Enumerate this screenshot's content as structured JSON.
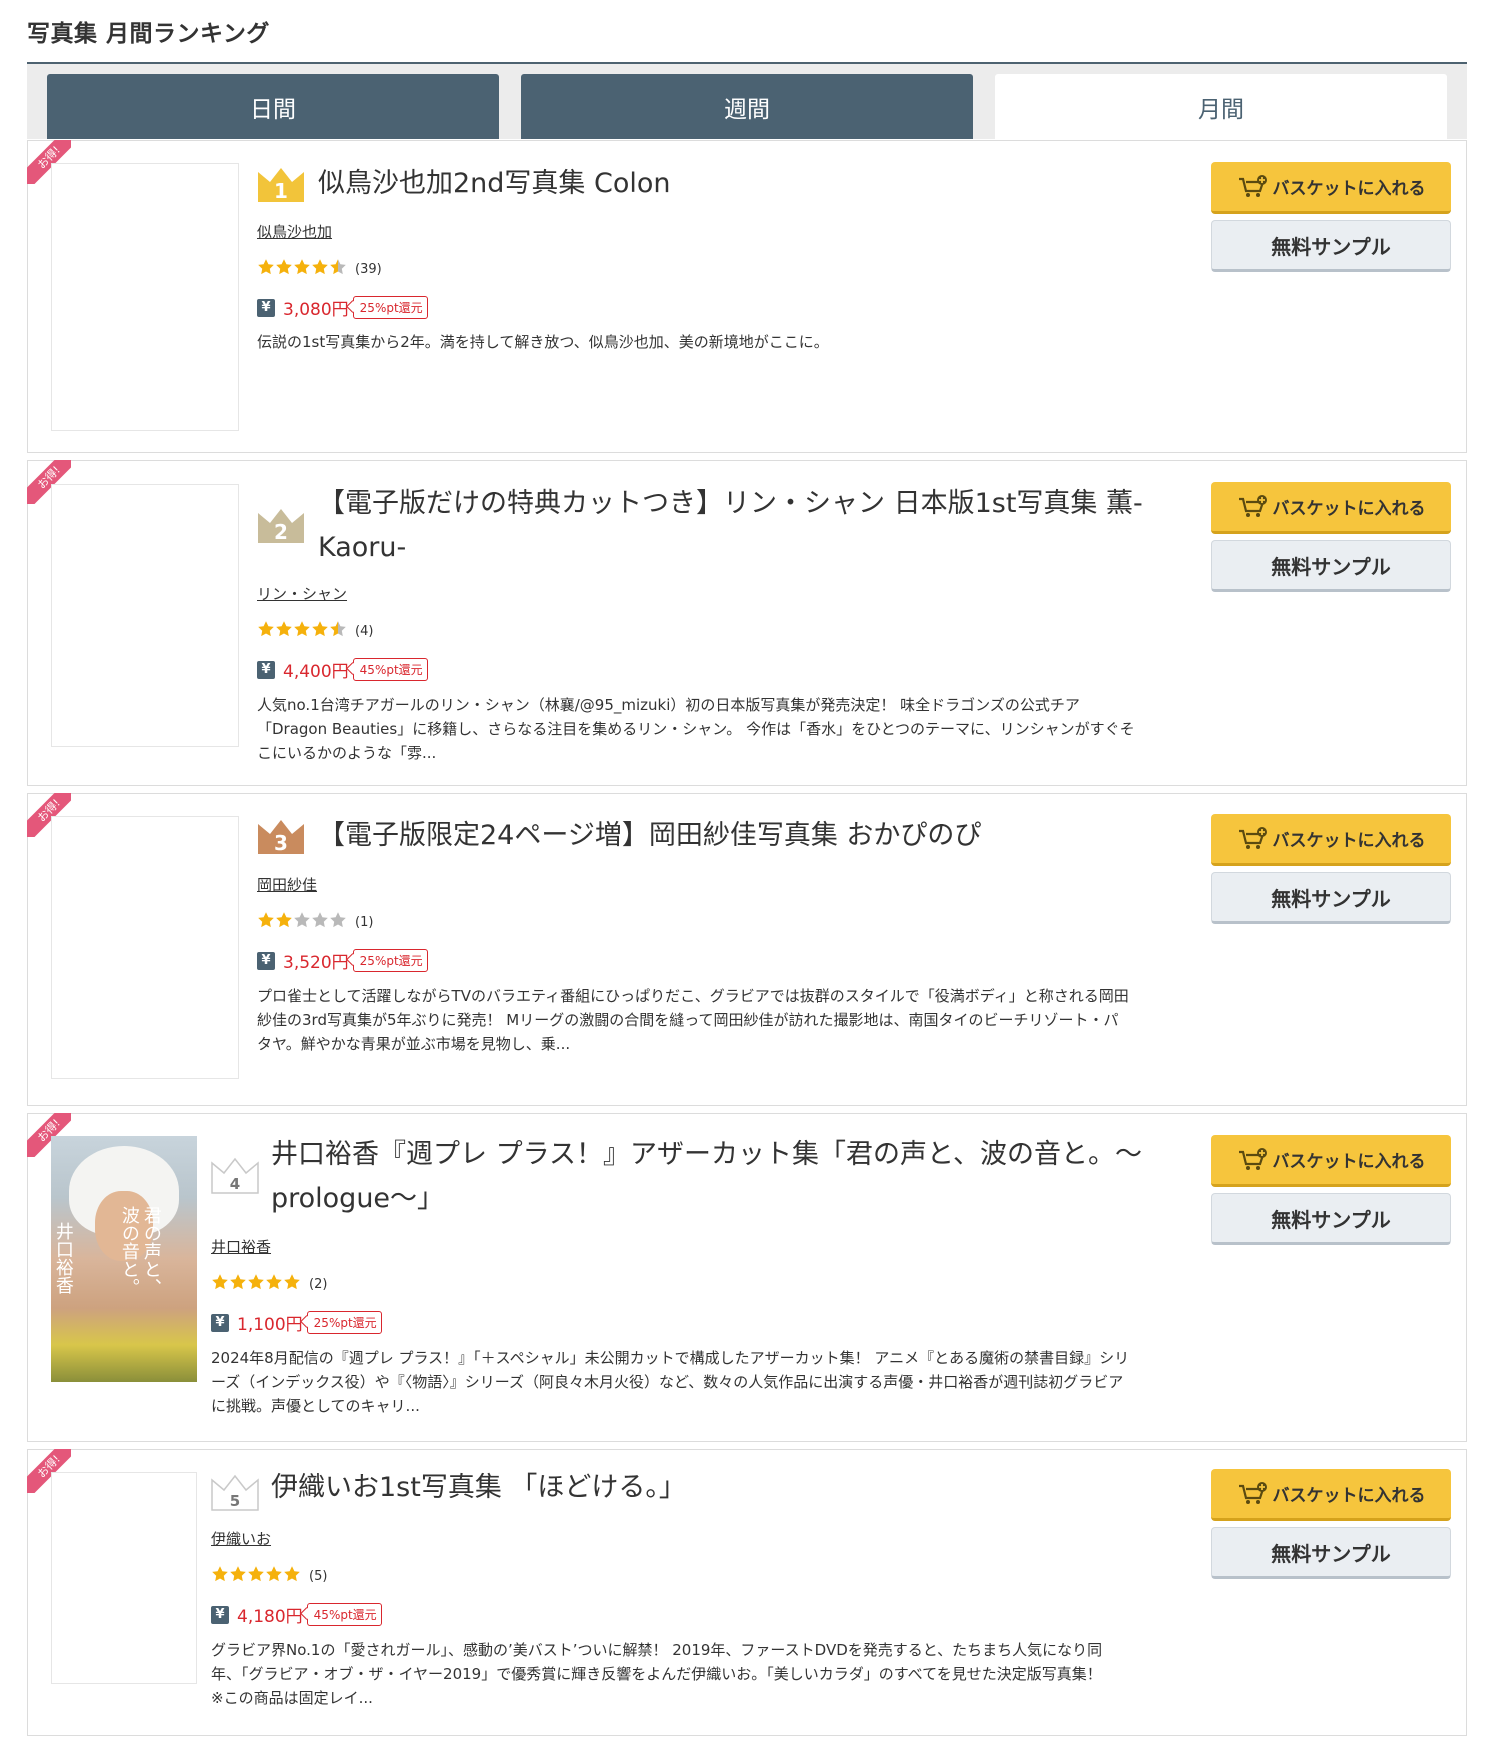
{
  "page_title": "写真集 月間ランキング",
  "tabs": [
    {
      "label": "日間",
      "active": false
    },
    {
      "label": "週間",
      "active": false
    },
    {
      "label": "月間",
      "active": true
    }
  ],
  "common": {
    "ribbon": "お得!",
    "basket_label": "バスケットに入れる",
    "sample_label": "無料サンプル",
    "yen": "¥"
  },
  "colors": {
    "tab_bg": "#4b6272",
    "accent_red": "#d9272e",
    "basket_yellow": "#f6c53d",
    "gold": "#f2c43a",
    "silver": "#c8bc9a",
    "bronze": "#c98b5e"
  },
  "items": [
    {
      "rank": "1",
      "crown": "gold",
      "title_lines": [
        "似鳥沙也加2nd写真集 Colon"
      ],
      "author": "似鳥沙也加",
      "rating": 4.5,
      "review_count": "(39)",
      "price": "3,080円",
      "points": "25%pt還元",
      "desc_lines": [
        "伝説の1st写真集から2年。満を持して解き放つ、似鳥沙也加、美の新境地がここに。"
      ]
    },
    {
      "rank": "2",
      "crown": "silver",
      "title_lines": [
        "【電子版だけの特典カットつき】リン・シャン 日本版1st写真集 薫-",
        "Kaoru-"
      ],
      "author": "リン・シャン",
      "rating": 4.5,
      "review_count": "(4)",
      "price": "4,400円",
      "points": "45%pt還元",
      "desc_lines": [
        "人気no.1台湾チアガールのリン・シャン（林襄/@95_mizuki）初の日本版写真集が発売決定！ 味全ドラゴンズの公式チア",
        "「Dragon Beauties」に移籍し、さらなる注目を集めるリン・シャン。 今作は「香水」をひとつのテーマに、リンシャンがすぐそ",
        "こにいるかのような「雰..."
      ]
    },
    {
      "rank": "3",
      "crown": "bronze",
      "title_lines": [
        "【電子版限定24ページ増】岡田紗佳写真集 おかぴのぴ"
      ],
      "author": "岡田紗佳",
      "rating": 2,
      "review_count": "(1)",
      "price": "3,520円",
      "points": "25%pt還元",
      "desc_lines": [
        "プロ雀士として活躍しながらTVのバラエティ番組にひっぱりだこ、グラビアでは抜群のスタイルで「役満ボディ」と称される岡田",
        "紗佳の3rd写真集が5年ぶりに発売！ Mリーグの激闘の合間を縫って岡田紗佳が訪れた撮影地は、南国タイのビーチリゾート・パ",
        "タヤ。鮮やかな青果が並ぶ市場を見物し、乗..."
      ]
    },
    {
      "rank": "4",
      "crown": "plain",
      "title_lines": [
        "井口裕香『週プレ プラス！』アザーカット集「君の声と、波の音と。～",
        "prologue～」"
      ],
      "author": "井口裕香",
      "rating": 5,
      "review_count": "(2)",
      "price": "1,100円",
      "points": "25%pt還元",
      "cover_text": [
        "君の声と、",
        "波の音と。",
        "井口裕香"
      ],
      "desc_lines": [
        "2024年8月配信の『週プレ プラス！』「＋スペシャル」未公開カットで構成したアザーカット集！ アニメ『とある魔術の禁書目録』シリ",
        "ーズ（インデックス役）や『〈物語〉』シリーズ（阿良々木月火役）など、数々の人気作品に出演する声優・井口裕香が週刊誌初グラビア",
        "に挑戦。声優としてのキャリ..."
      ]
    },
    {
      "rank": "5",
      "crown": "plain",
      "title_lines": [
        "伊織いお1st写真集 「ほどける。」"
      ],
      "author": "伊織いお",
      "rating": 5,
      "review_count": "(5)",
      "price": "4,180円",
      "points": "45%pt還元",
      "desc_lines": [
        "グラビア界No.1の「愛されガール」、感動の’美バスト’ついに解禁！ 2019年、ファーストDVDを発売すると、たちまち人気になり同",
        "年、「グラビア・オブ・ザ・イヤー2019」で優秀賞に輝き反響をよんだ伊織いお。「美しいカラダ」のすべてを見せた決定版写真集！",
        "※この商品は固定レイ..."
      ]
    }
  ]
}
